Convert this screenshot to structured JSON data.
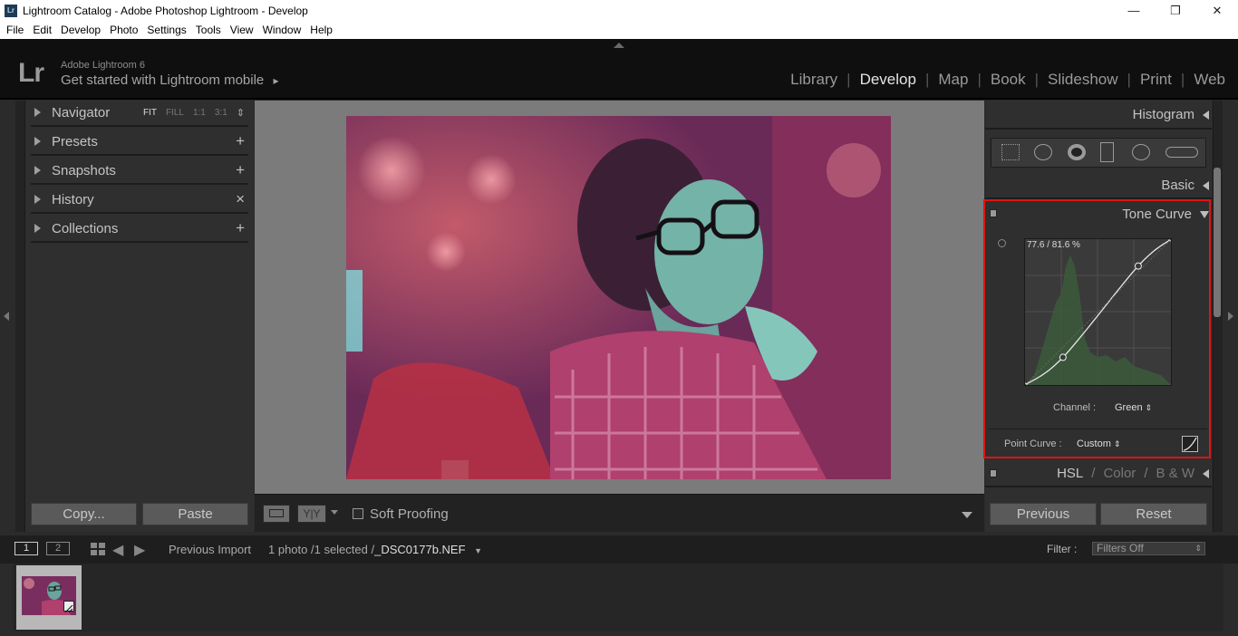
{
  "window": {
    "app_icon": "Lr",
    "title": "Lightroom Catalog - Adobe Photoshop Lightroom - Develop",
    "minimize_glyph": "—",
    "maximize_glyph": "❐",
    "close_glyph": "✕"
  },
  "menu": [
    "File",
    "Edit",
    "Develop",
    "Photo",
    "Settings",
    "Tools",
    "View",
    "Window",
    "Help"
  ],
  "identity": {
    "logo": "Lr",
    "product": "Adobe Lightroom 6",
    "mobile_prompt": "Get started with Lightroom mobile",
    "mobile_arrow": "▸"
  },
  "modules": [
    {
      "label": "Library",
      "active": false
    },
    {
      "label": "Develop",
      "active": true
    },
    {
      "label": "Map",
      "active": false
    },
    {
      "label": "Book",
      "active": false
    },
    {
      "label": "Slideshow",
      "active": false
    },
    {
      "label": "Print",
      "active": false
    },
    {
      "label": "Web",
      "active": false
    }
  ],
  "left_panel": {
    "navigator": {
      "label": "Navigator",
      "options": [
        "FIT",
        "FILL",
        "1:1",
        "3:1"
      ],
      "selected": "FIT",
      "stepper": "⇕"
    },
    "presets": {
      "label": "Presets",
      "action": "+"
    },
    "snapshots": {
      "label": "Snapshots",
      "action": "+"
    },
    "history": {
      "label": "History",
      "action": "×"
    },
    "collections": {
      "label": "Collections",
      "action": "+"
    },
    "copy_button": "Copy...",
    "paste_button": "Paste"
  },
  "toolbar": {
    "soft_proofing": "Soft Proofing",
    "soft_proofing_checked": false,
    "compare_label": "Y|Y"
  },
  "right_panel": {
    "histogram": "Histogram",
    "basic": "Basic",
    "tone_curve": {
      "title": "Tone Curve",
      "readout": "77.6 / 81.6 %",
      "channel_label": "Channel :",
      "channel_value": "Green",
      "point_curve_label": "Point Curve :",
      "point_curve_value": "Custom",
      "curve_points": [
        [
          0,
          0
        ],
        [
          26,
          19
        ],
        [
          77.6,
          81.6
        ],
        [
          100,
          100
        ]
      ]
    },
    "hsl_tabs": [
      "HSL",
      "Color",
      "B & W"
    ],
    "hsl_separator": "/",
    "previous_button": "Previous",
    "reset_button": "Reset"
  },
  "filmstrip": {
    "view1": "1",
    "view2": "2",
    "source": "Previous Import",
    "info": "1 photo /1 selected /",
    "filename": "_DSC0177b.NEF",
    "filter_label": "Filter :",
    "filter_value": "Filters Off"
  },
  "colors": {
    "highlight_box": "#e01414",
    "active_module": "#e4e4e4",
    "panel_bg": "#2f2f2f"
  }
}
